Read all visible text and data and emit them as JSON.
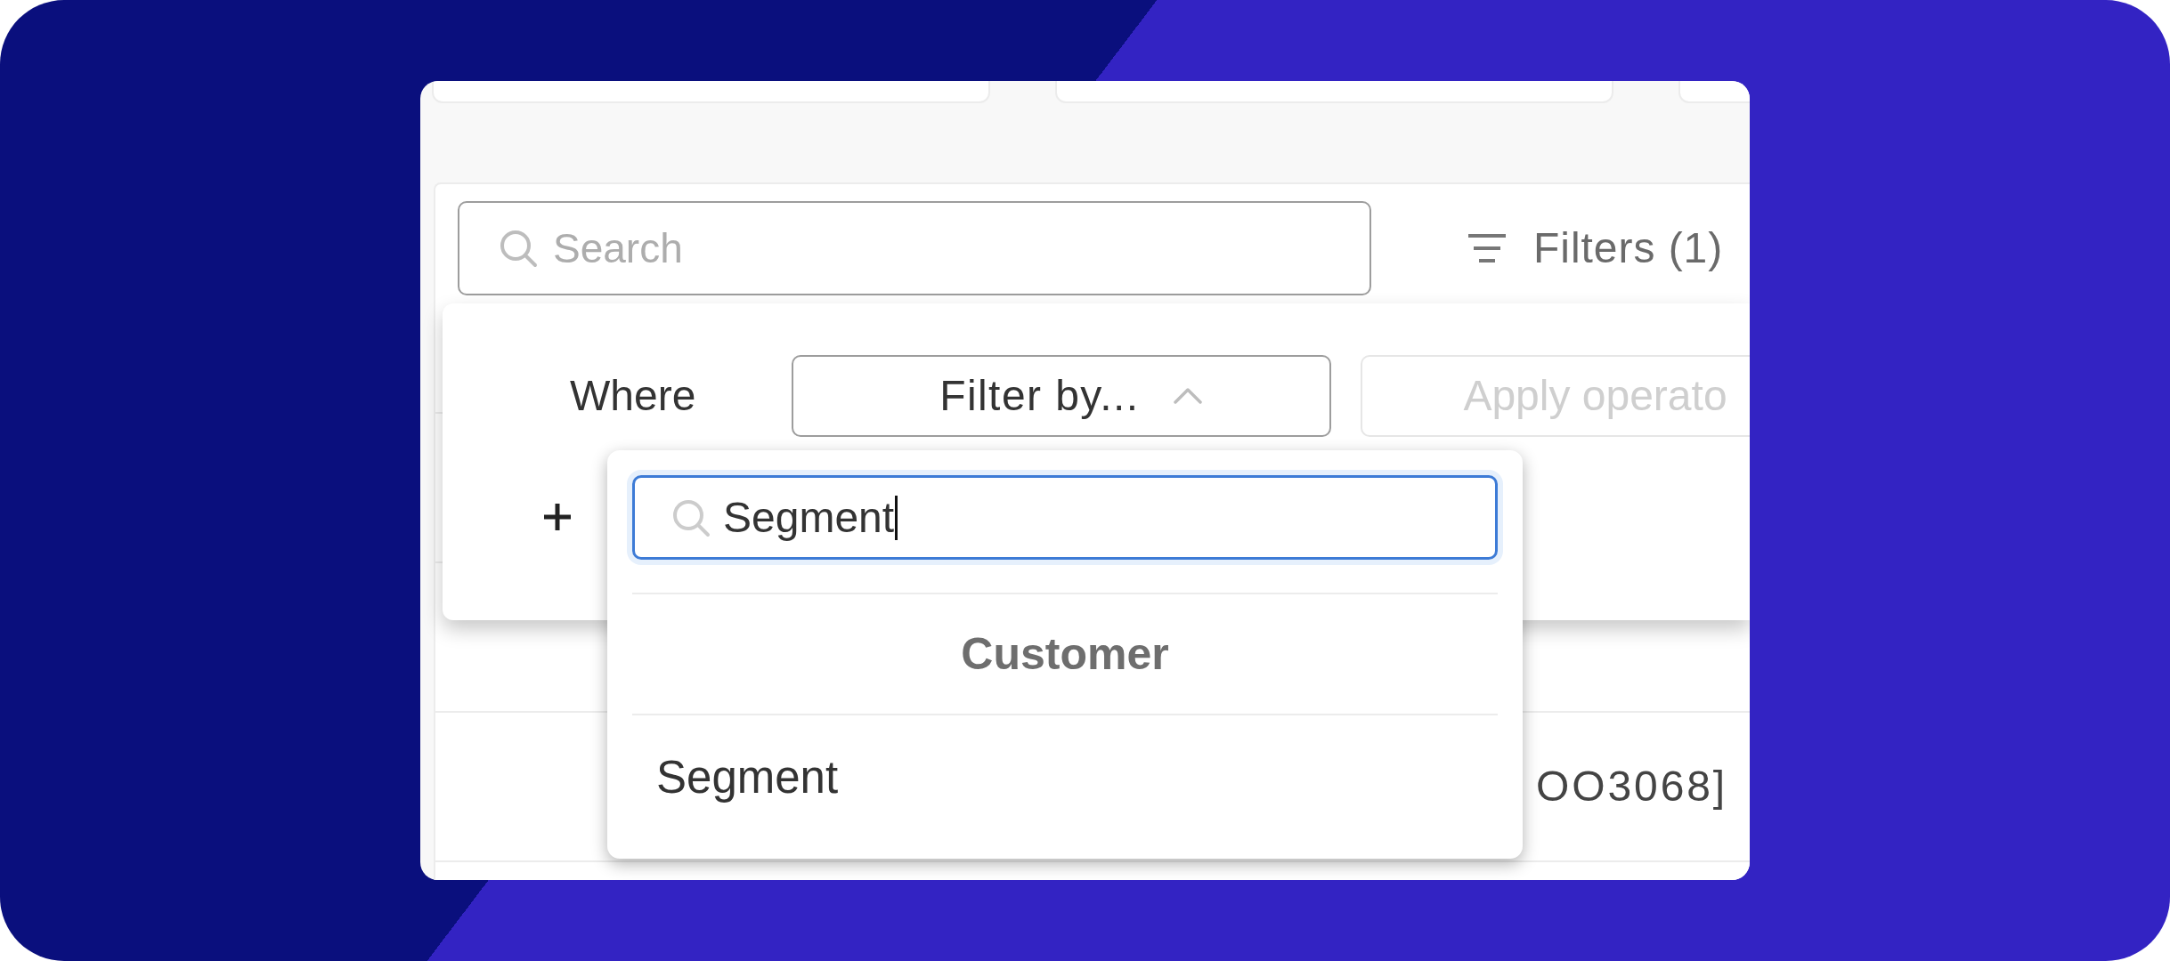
{
  "toolbar": {
    "search": {
      "placeholder": "Search"
    },
    "filters_button": {
      "label": "Filters (1)"
    }
  },
  "table": {
    "rows": [
      {
        "cells": [
          "OO3068]"
        ]
      }
    ]
  },
  "filter_panel": {
    "where_label": "Where",
    "field_select": {
      "label": "Filter by...",
      "expanded": true
    },
    "operator_select": {
      "placeholder": "Apply operato",
      "disabled": true
    }
  },
  "field_dropdown": {
    "search": {
      "value": "Segment"
    },
    "groups": [
      {
        "title": "Customer",
        "options": [
          {
            "label": "Segment",
            "selected": false
          }
        ]
      }
    ]
  }
}
